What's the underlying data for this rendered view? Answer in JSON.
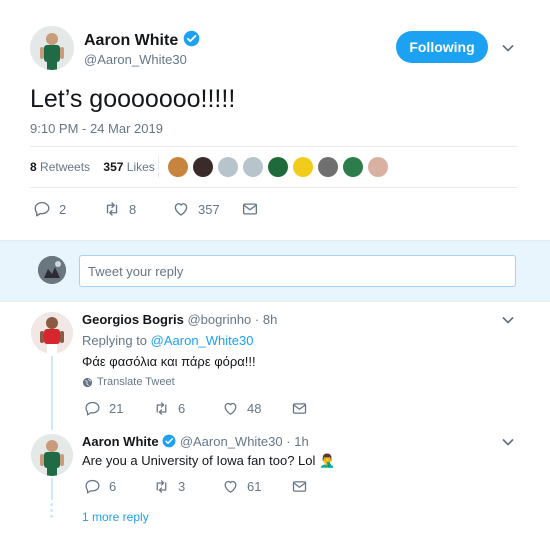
{
  "tweet": {
    "display_name": "Aaron White",
    "handle": "@Aaron_White30",
    "follow_label": "Following",
    "text": "Let’s gooooooo!!!!!",
    "timestamp": "9:10 PM - 24 Mar 2019",
    "stats": {
      "retweets_count": "8",
      "retweets_label": "Retweets",
      "likes_count": "357",
      "likes_label": "Likes"
    },
    "actions": {
      "replies": "2",
      "retweets": "8",
      "likes": "357"
    }
  },
  "reply_box": {
    "placeholder": "Tweet your reply"
  },
  "replies": [
    {
      "display_name": "Georgios Bogris",
      "handle": "@bogrinho",
      "time": "8h",
      "replying_to_label": "Replying to",
      "replying_to_handle": "@Aaron_White30",
      "text": "Φάε φασόλια και πάρε φόρα!!!",
      "translate_label": "Translate Tweet",
      "actions": {
        "retweets": "21",
        "likes": "6",
        "hearts": "48"
      }
    },
    {
      "display_name": "Aaron White",
      "handle": "@Aaron_White30",
      "time": "1h",
      "text": "Are you a University of Iowa fan too? Lol 🤦‍♂️",
      "actions": {
        "replies": "6",
        "retweets": "3",
        "likes": "61"
      }
    }
  ],
  "more_replies_label": "1 more reply",
  "colors": {
    "accent": "#1da1f2",
    "verified": "#1da1f2",
    "muted_text": "#657786",
    "divider": "#e6ecf0",
    "thread_line": "#cfe7fb"
  }
}
